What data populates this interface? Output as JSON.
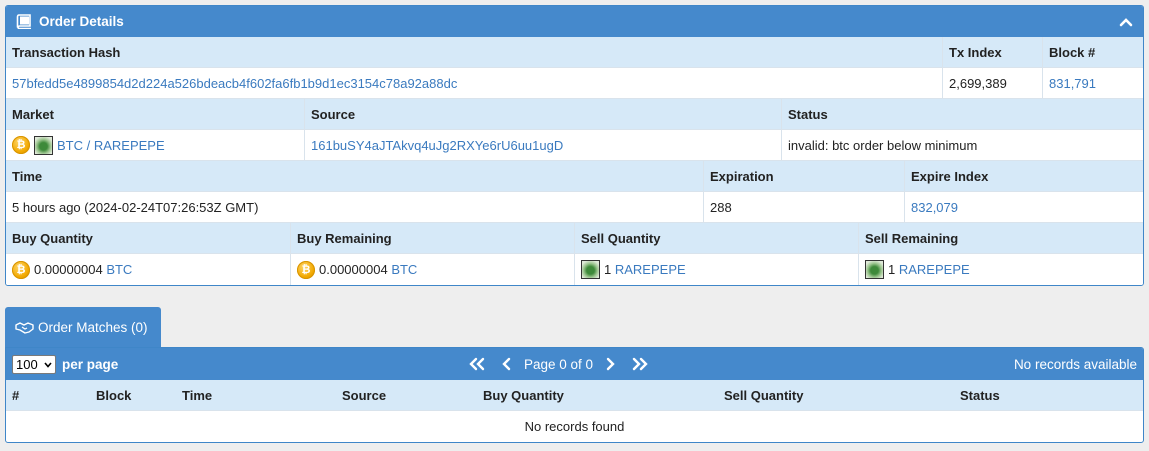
{
  "panel": {
    "title": "Order Details"
  },
  "row1": {
    "headers": [
      "Transaction Hash",
      "Tx Index",
      "Block #"
    ],
    "tx_hash": "57bfedd5e4899854d2d224a526bdeacb4f602fa6fb1b9d1ec3154c78a92a88dc",
    "tx_index": "2,699,389",
    "block": "831,791"
  },
  "row2": {
    "headers": [
      "Market",
      "Source",
      "Status"
    ],
    "market": "BTC / RAREPEPE",
    "source": "161buSY4aJTAkvq4uJg2RXYe6rU6uu1ugD",
    "status": "invalid: btc order below minimum"
  },
  "row3": {
    "headers": [
      "Time",
      "Expiration",
      "Expire Index"
    ],
    "time": "5 hours ago (2024-02-24T07:26:53Z GMT)",
    "expiration": "288",
    "expire_index": "832,079"
  },
  "row4": {
    "headers": [
      "Buy Quantity",
      "Buy Remaining",
      "Sell Quantity",
      "Sell Remaining"
    ],
    "buy_qty": "0.00000004",
    "buy_asset": "BTC",
    "buy_rem": "0.00000004",
    "buy_rem_asset": "BTC",
    "sell_qty": "1",
    "sell_asset": "RAREPEPE",
    "sell_rem": "1",
    "sell_rem_asset": "RAREPEPE"
  },
  "tab": {
    "label": "Order Matches (0)"
  },
  "matches": {
    "per_page_value": "100",
    "per_page_label": "per page",
    "page_text": "Page 0 of 0",
    "no_records_available": "No records available",
    "columns": [
      "#",
      "Block",
      "Time",
      "Source",
      "Buy Quantity",
      "Sell Quantity",
      "Status"
    ],
    "empty_text": "No records found"
  },
  "icons": {
    "btc_symbol": "₿"
  },
  "colors": {
    "header_blue": "#4589cc",
    "row_header": "#d6e9f8",
    "link": "#3a7abf"
  }
}
